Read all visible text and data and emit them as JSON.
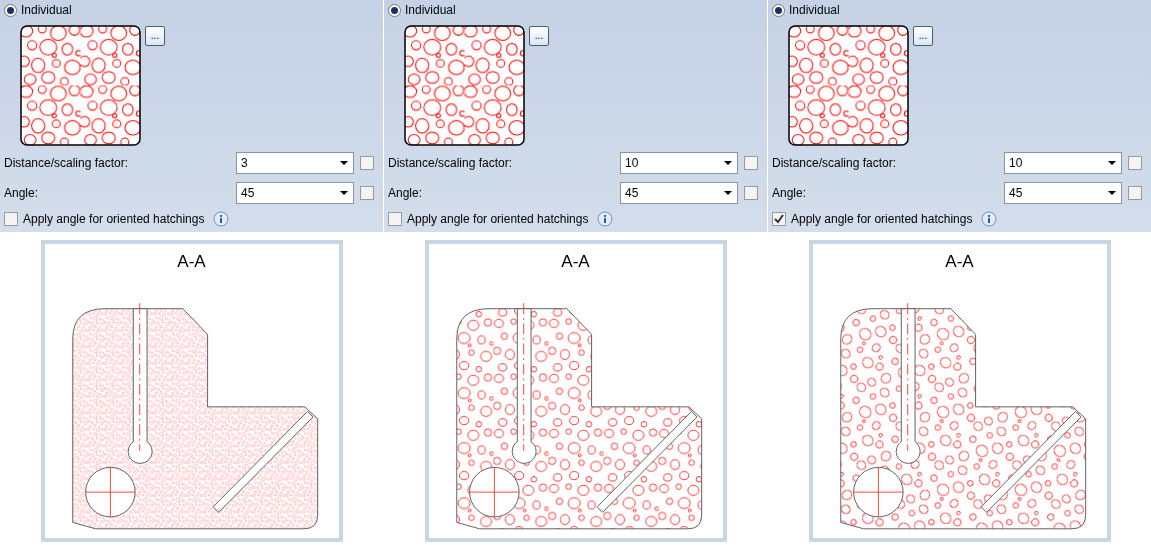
{
  "panels": [
    {
      "mode": {
        "label": "Individual",
        "selected": true
      },
      "more_button": "...",
      "fields": [
        {
          "label": "Distance/scaling factor:",
          "value": "3",
          "checked": false
        },
        {
          "label": "Angle:",
          "value": "45",
          "checked": false
        }
      ],
      "oriented": {
        "label": "Apply angle for oriented hatchings",
        "checked": false
      },
      "drawing": {
        "title": "A-A"
      }
    },
    {
      "mode": {
        "label": "Individual",
        "selected": true
      },
      "more_button": "...",
      "fields": [
        {
          "label": "Distance/scaling factor:",
          "value": "10",
          "checked": false
        },
        {
          "label": "Angle:",
          "value": "45",
          "checked": false
        }
      ],
      "oriented": {
        "label": "Apply angle for oriented hatchings",
        "checked": false
      },
      "drawing": {
        "title": "A-A"
      }
    },
    {
      "mode": {
        "label": "Individual",
        "selected": true
      },
      "more_button": "...",
      "fields": [
        {
          "label": "Distance/scaling factor:",
          "value": "10",
          "checked": false
        },
        {
          "label": "Angle:",
          "value": "45",
          "checked": false
        }
      ],
      "oriented": {
        "label": "Apply angle for oriented hatchings",
        "checked": true
      },
      "drawing": {
        "title": "A-A"
      }
    }
  ]
}
